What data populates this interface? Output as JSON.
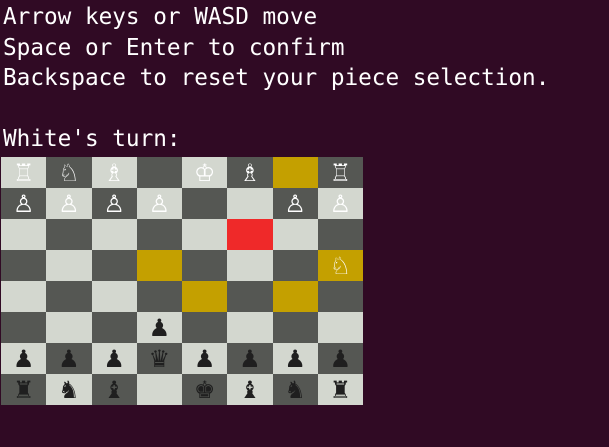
{
  "instructions": {
    "line1": "Arrow keys or WASD move",
    "line2": "Space or Enter to confirm",
    "line3": "Backspace to reset your piece selection."
  },
  "status": {
    "turn_text": "White's turn:"
  },
  "colors": {
    "terminal_bg": "#300a24",
    "light_square": "#d3d7cf",
    "dark_square": "#555753",
    "move_highlight": "#c4a000",
    "selected_highlight": "#ef2929",
    "white_piece": "#ffffff",
    "black_piece": "#1f1f1f"
  },
  "board": {
    "ranks": [
      "RNB.KB.R",
      "PPPP..PP",
      "........",
      ".......N",
      "........",
      "...p....",
      "pppqpppp",
      "rnb.kbnr"
    ],
    "selected": [
      2,
      5
    ],
    "moves": [
      [
        0,
        6
      ],
      [
        3,
        3
      ],
      [
        3,
        7
      ],
      [
        4,
        4
      ],
      [
        4,
        6
      ]
    ],
    "glyphs": {
      "K": "♔",
      "Q": "♕",
      "R": "♖",
      "B": "♗",
      "N": "♘",
      "P": "♙",
      "k": "♚",
      "q": "♛",
      "r": "♜",
      "b": "♝",
      "n": "♞",
      "p": "♟"
    },
    "piece_names": {
      "K": "white-king",
      "Q": "white-queen",
      "R": "white-rook",
      "B": "white-bishop",
      "N": "white-knight",
      "P": "white-pawn",
      "k": "black-king",
      "q": "black-queen",
      "r": "black-rook",
      "b": "black-bishop",
      "n": "black-knight",
      "p": "black-pawn"
    },
    "icon_names": {
      "K": "king-icon",
      "Q": "queen-icon",
      "R": "rook-icon",
      "B": "bishop-icon",
      "N": "knight-icon",
      "P": "pawn-icon",
      "k": "king-icon",
      "q": "queen-icon",
      "r": "rook-icon",
      "b": "bishop-icon",
      "n": "knight-icon",
      "p": "pawn-icon"
    }
  }
}
